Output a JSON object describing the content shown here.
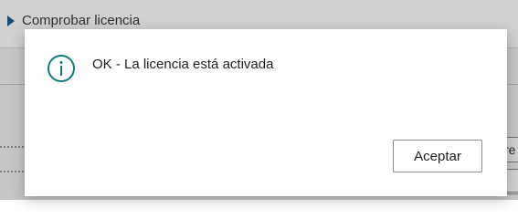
{
  "background": {
    "action_label": "Comprobar licencia",
    "field_partial_text": "re"
  },
  "dialog": {
    "icon": "info-icon",
    "message": "OK - La licencia está activada",
    "accept_label": "Aceptar"
  },
  "colors": {
    "icon_teal": "#0f7b7c",
    "action_arrow": "#1f5c8a"
  }
}
